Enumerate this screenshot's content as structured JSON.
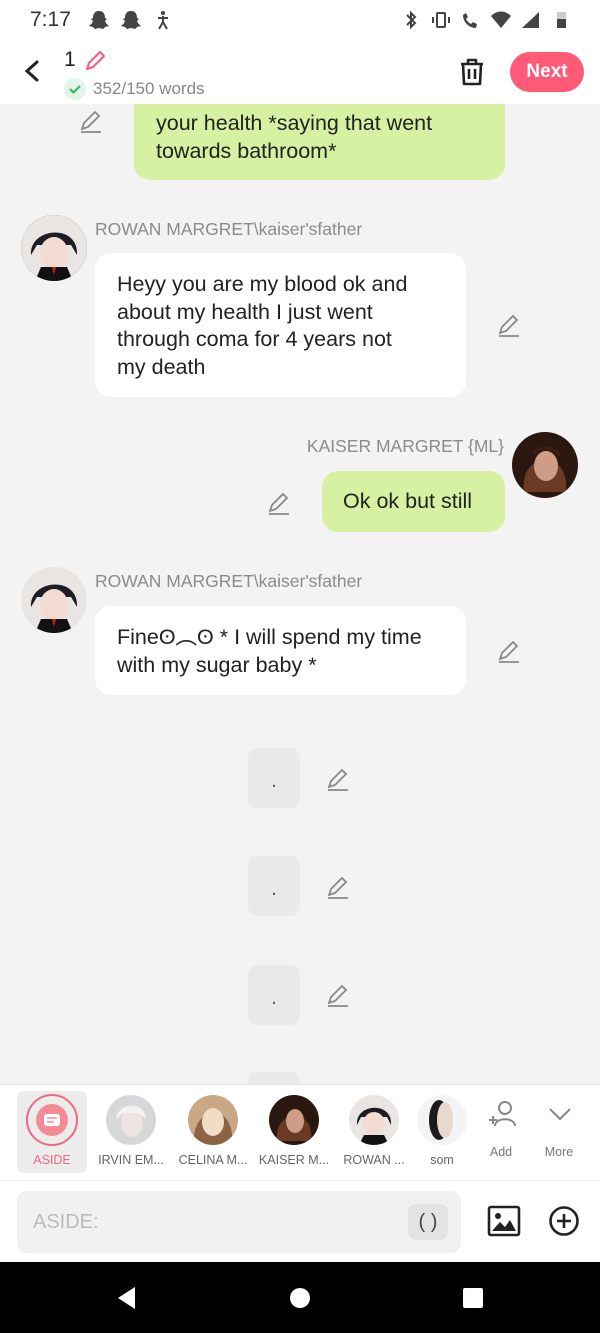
{
  "status_bar": {
    "time": "7:17",
    "left_icons": [
      "snapchat-icon",
      "snapchat-icon",
      "accessibility-icon"
    ],
    "right_icons": [
      "bluetooth-icon",
      "vibrate-icon",
      "wifi-calling-icon",
      "wifi-icon",
      "signal-icon",
      "battery-icon"
    ]
  },
  "header": {
    "title": "1",
    "word_count": "352/150 words",
    "next_label": "Next",
    "accent_color": "#ff5a78"
  },
  "messages": [
    {
      "side": "right",
      "sender": "",
      "text": "your health *saying that went\ntowards bathroom*",
      "partial": true
    },
    {
      "side": "left",
      "sender": "ROWAN MARGRET\\kaiser'sfather",
      "text": "Heyy you are my blood  ok and\nabout my health I just went\nthrough coma for 4 years not\nmy death"
    },
    {
      "side": "right",
      "sender": "KAISER MARGRET {ML}",
      "text": "Ok ok but still"
    },
    {
      "side": "left",
      "sender": "ROWAN MARGRET\\kaiser'sfather",
      "text": "Fineʘ︵ʘ * I will spend my time\nwith my sugar baby *"
    },
    {
      "side": "center",
      "text": "."
    },
    {
      "side": "center",
      "text": "."
    },
    {
      "side": "center",
      "text": "."
    }
  ],
  "characters": [
    {
      "label": "ASIDE",
      "active": true
    },
    {
      "label": "IRVIN EM..."
    },
    {
      "label": "CELINA M..."
    },
    {
      "label": "KAISER M..."
    },
    {
      "label": "ROWAN ..."
    },
    {
      "label": "som"
    }
  ],
  "tools": {
    "add_label": "Add",
    "more_label": "More"
  },
  "input": {
    "placeholder": "ASIDE:",
    "paren_label": "( )"
  },
  "colors": {
    "bubble_right": "#d5f1a1",
    "bubble_left": "#ffffff",
    "aside_accent": "#f06a7c"
  }
}
